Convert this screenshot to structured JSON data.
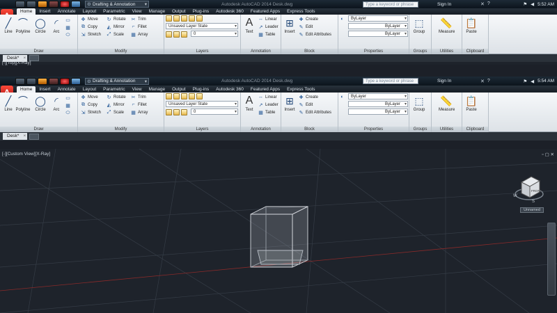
{
  "app": {
    "title": "Autodesk AutoCAD 2014   Desk.dwg",
    "logo_letter": "A",
    "search_placeholder": "Type a keyword or phrase",
    "signin": "Sign In"
  },
  "windows": [
    {
      "workspace": "Drafting & Annotation",
      "clock": "5:52 AM",
      "viewport_label": "[-][Top][X-Ray]"
    },
    {
      "workspace": "Drafting & Annotation",
      "clock": "5:54 AM",
      "viewport_label": "[-][Custom View][X-Ray]"
    }
  ],
  "ribbon": {
    "tabs": [
      "Home",
      "Insert",
      "Annotate",
      "Layout",
      "Parametric",
      "View",
      "Manage",
      "Output",
      "Plug-ins",
      "Autodesk 360",
      "Featured Apps",
      "Express Tools"
    ],
    "draw": {
      "title": "Draw",
      "tools": [
        "Line",
        "Polyline",
        "Circle",
        "Arc"
      ]
    },
    "modify": {
      "title": "Modify",
      "col1": [
        "Move",
        "Copy",
        "Stretch"
      ],
      "col2": [
        "Rotate",
        "Mirror",
        "Scale"
      ],
      "col3": [
        "Trim",
        "Fillet",
        "Array"
      ]
    },
    "layers": {
      "title": "Layers",
      "state": "Unsaved Layer State",
      "current": "0"
    },
    "annotation": {
      "title": "Annotation",
      "text": "Text",
      "col": [
        "Linear",
        "Leader",
        "Table"
      ]
    },
    "block": {
      "title": "Block",
      "insert": "Insert",
      "col": [
        "Create",
        "Edit",
        "Edit Attributes"
      ]
    },
    "properties": {
      "title": "Properties",
      "color": "ByLayer",
      "linetype": "ByLayer",
      "lineweight": "ByLayer"
    },
    "groups": {
      "title": "Groups",
      "label": "Group"
    },
    "utilities": {
      "title": "Utilities",
      "label": "Measure"
    },
    "clipboard": {
      "title": "Clipboard",
      "label": "Paste"
    }
  },
  "document_tab": "Desk*",
  "viewcube": {
    "face": "FRONT",
    "compass": [
      "W",
      "S"
    ],
    "view_name": "Unnamed"
  },
  "colors": {
    "ribbon_bg": "#e6eaee",
    "canvas_bg": "#1e232b",
    "accent_red": "#c0392b"
  }
}
